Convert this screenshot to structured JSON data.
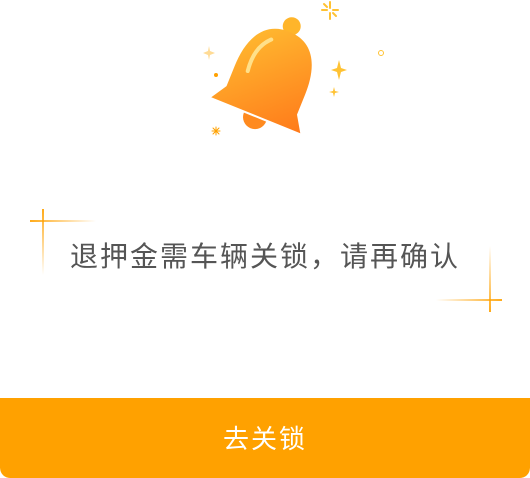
{
  "dialog": {
    "message": "退押金需车辆关锁，请再确认",
    "confirm_label": "去关锁"
  },
  "icons": {
    "main": "bell-icon",
    "decorations": [
      "sparkle-icon",
      "star-icon"
    ]
  },
  "colors": {
    "accent": "#FFA100",
    "bell_light": "#FFB52A",
    "bell_dark": "#FF7A1A",
    "text": "#555555"
  }
}
